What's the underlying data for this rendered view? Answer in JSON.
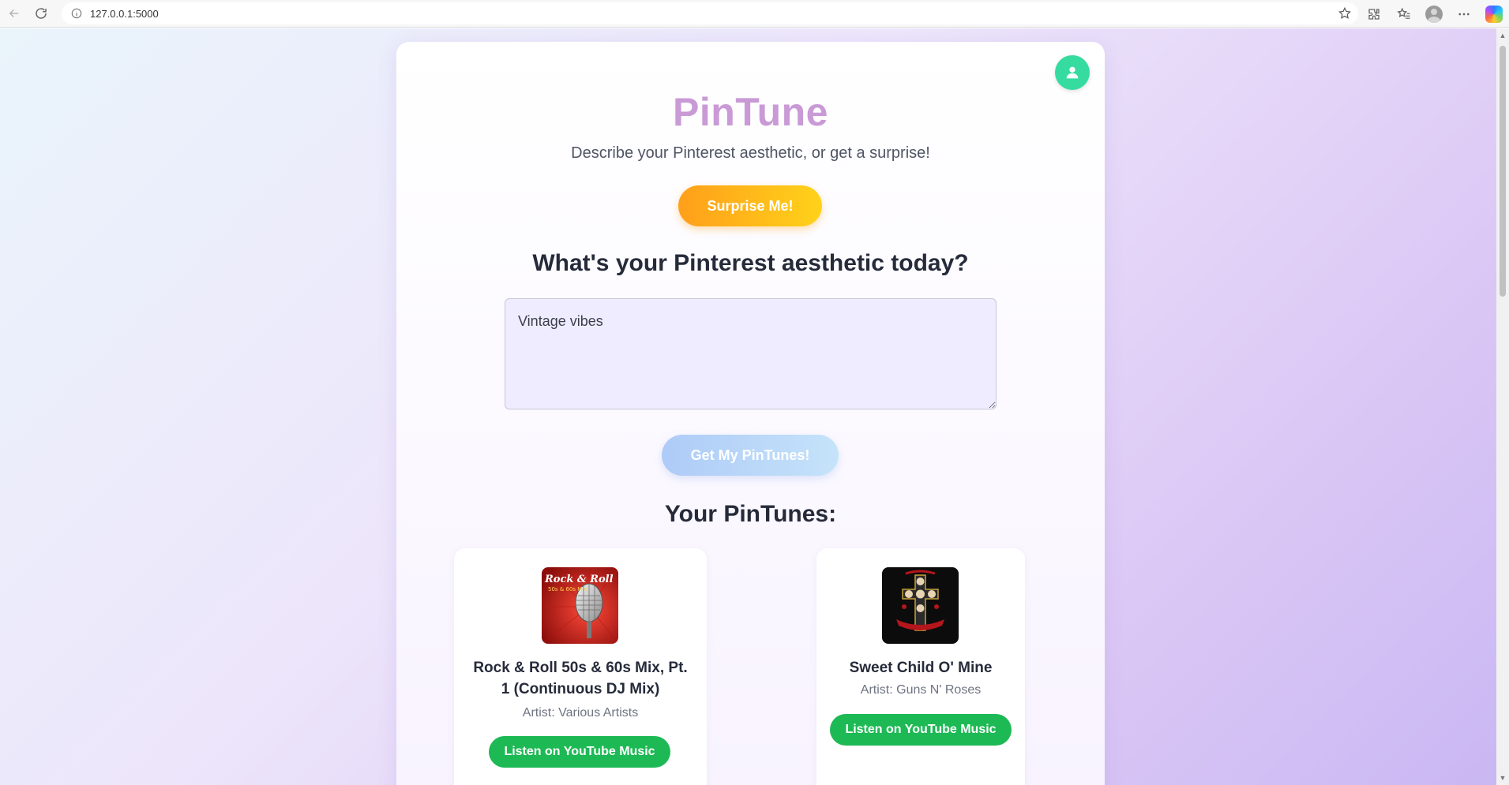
{
  "browser": {
    "url": "127.0.0.1:5000",
    "icons": [
      "back-icon",
      "reload-icon",
      "info-icon",
      "star-icon",
      "extensions-icon",
      "favorites-icon",
      "profile-icon",
      "more-icon",
      "copilot-icon"
    ]
  },
  "app": {
    "title": "PinTune",
    "subtitle": "Describe your Pinterest aesthetic, or get a surprise!",
    "surprise_button": "Surprise Me!",
    "question": "What's your Pinterest aesthetic today?",
    "aesthetic_input_value": "Vintage vibes",
    "get_button": "Get My PinTunes!",
    "results_title": "Your PinTunes:",
    "colors": {
      "title": "#c99ad6",
      "surprise_gradient": [
        "#ff9f1a",
        "#ffd21a"
      ],
      "get_gradient": [
        "#aecbf8",
        "#c5e3f9"
      ],
      "listen_button": "#1db954",
      "avatar": "#36dba0"
    }
  },
  "songs": [
    {
      "title": "Rock & Roll 50s & 60s Mix, Pt. 1 (Continuous DJ Mix)",
      "artist": "Artist: Various Artists",
      "button": "Listen on YouTube Music",
      "cover_text": "Rock & Roll",
      "cover_subtext": "50s & 60s Mix"
    },
    {
      "title": "Sweet Child O' Mine",
      "artist": "Artist: Guns N' Roses",
      "button": "Listen on YouTube Music"
    }
  ]
}
